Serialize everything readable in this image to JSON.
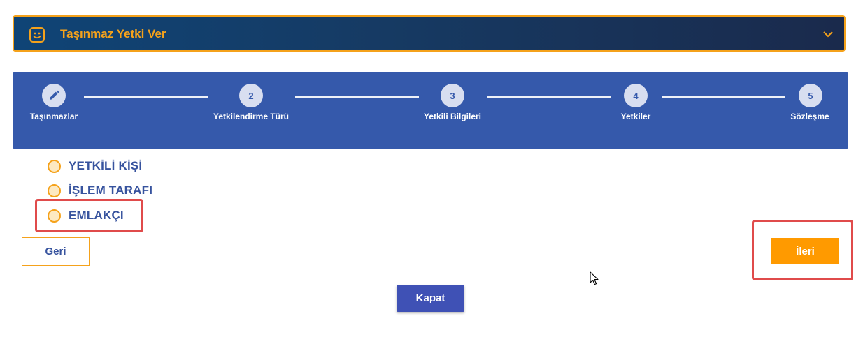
{
  "header": {
    "title": "Taşınmaz Yetki Ver",
    "icon": "smiley-icon",
    "toggle_icon": "chevron-down-icon"
  },
  "stepper": {
    "steps": [
      {
        "number": "",
        "label": "Taşınmazlar",
        "icon": "pencil-icon",
        "state": "completed"
      },
      {
        "number": "2",
        "label": "Yetkilendirme Türü",
        "state": "current"
      },
      {
        "number": "3",
        "label": "Yetkili Bilgileri",
        "state": "pending"
      },
      {
        "number": "4",
        "label": "Yetkiler",
        "state": "pending"
      },
      {
        "number": "5",
        "label": "Sözleşme",
        "state": "pending"
      }
    ]
  },
  "options": [
    {
      "label": "YETKİLİ KİŞİ",
      "selected": false
    },
    {
      "label": "İŞLEM TARAFI",
      "selected": false
    },
    {
      "label": "EMLAKÇI",
      "selected": false
    }
  ],
  "buttons": {
    "back": "Geri",
    "next": "İleri",
    "close": "Kapat"
  },
  "colors": {
    "accent": "#f5a21b",
    "stepper_bg": "#3559ab",
    "next_button": "#ff9a00",
    "close_button": "#3f51b5",
    "highlight": "#e04b4b"
  }
}
